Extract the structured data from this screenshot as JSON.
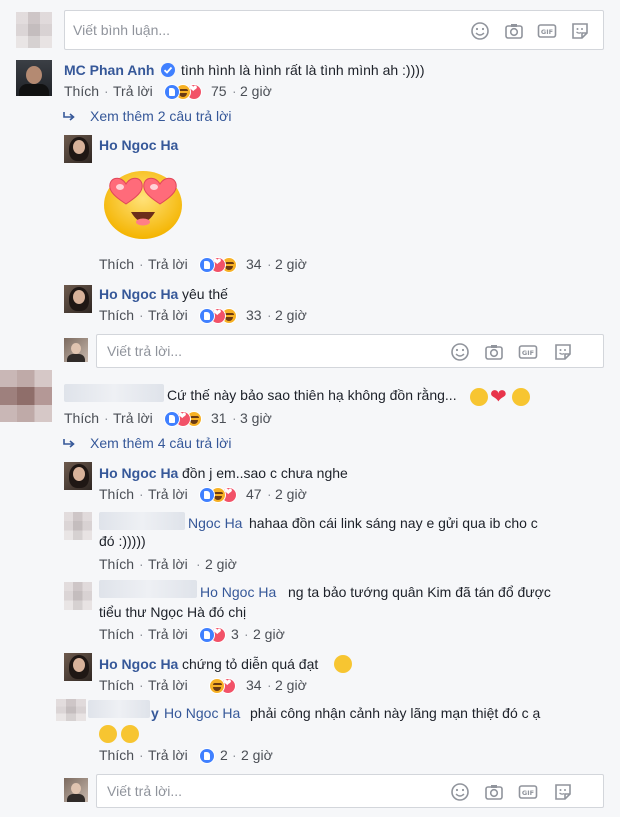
{
  "composer_top": {
    "placeholder": "Viết bình luận..."
  },
  "comments": [
    {
      "author": "MC Phan Anh",
      "verified": true,
      "text": "tình hình là hình rất là tình mình ah :))))",
      "like": "Thích",
      "reply": "Trả lời",
      "reaction_count": "75",
      "time": "2 giờ",
      "more_replies": "Xem thêm 2 câu trả lời",
      "replies": [
        {
          "author": "Ho Ngoc Ha",
          "text": "",
          "sticker": "heart-eyes-emoji",
          "like": "Thích",
          "reply": "Trả lời",
          "reaction_count": "34",
          "time": "2 giờ"
        },
        {
          "author": "Ho Ngoc Ha",
          "text": "yêu thế",
          "like": "Thích",
          "reply": "Trả lời",
          "reaction_count": "33",
          "time": "2 giờ"
        }
      ],
      "reply_composer": {
        "placeholder": "Viết trả lời..."
      }
    },
    {
      "author": "",
      "text": "Cứ thế này bảo sao thiên hạ không đồn rằng...",
      "like": "Thích",
      "reply": "Trả lời",
      "reaction_count": "31",
      "time": "3 giờ",
      "more_replies": "Xem thêm 4 câu trả lời",
      "replies": [
        {
          "author": "Ho Ngoc Ha",
          "text": "đồn j em..sao c chưa nghe",
          "like": "Thích",
          "reply": "Trả lời",
          "reaction_count": "47",
          "time": "2 giờ"
        },
        {
          "author": "",
          "mention": "Ngoc Ha",
          "text_line1": "hahaa đồn cái link sáng nay e gửi qua ib cho c",
          "text_line2": "đó :)))))",
          "like": "Thích",
          "reply": "Trả lời",
          "time": "2 giờ"
        },
        {
          "author": "",
          "mention": "Ho Ngoc Ha",
          "text_line1": "ng ta bảo tướng quân Kim đã tán đổ được",
          "text_line2": "tiểu thư Ngọc Hà đó chị",
          "like": "Thích",
          "reply": "Trả lời",
          "reaction_count": "3",
          "time": "2 giờ"
        },
        {
          "author": "Ho Ngoc Ha",
          "text": "chứng tỏ diễn quá đạt",
          "like": "Thích",
          "reply": "Trả lời",
          "reaction_count": "34",
          "time": "2 giờ"
        },
        {
          "author_suffix": "y",
          "mention": "Ho Ngoc Ha",
          "text": "phải công nhận cảnh này lãng mạn thiệt đó c ạ",
          "like": "Thích",
          "reply": "Trả lời",
          "reaction_count": "2",
          "time": "2 giờ"
        }
      ],
      "reply_composer": {
        "placeholder": "Viết trả lời..."
      }
    }
  ],
  "colors": {
    "link": "#365899",
    "meta": "#4b4f56",
    "bg": "#f6f7f9",
    "like": "#4080ff",
    "love": "#f25268",
    "haha": "#f7b125"
  }
}
